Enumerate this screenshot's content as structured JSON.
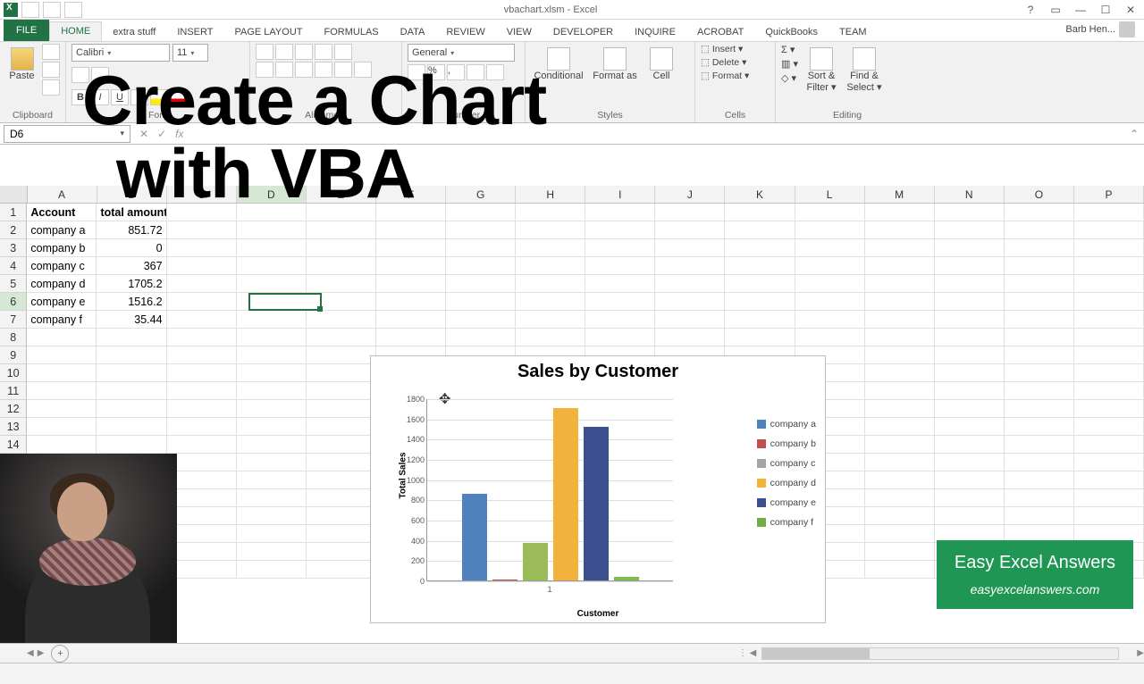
{
  "window": {
    "title": "vbachart.xlsm - Excel"
  },
  "qat": {
    "icons": [
      "xl",
      "save",
      "undo",
      "redo"
    ]
  },
  "tabs": [
    "FILE",
    "HOME",
    "extra stuff",
    "INSERT",
    "PAGE LAYOUT",
    "FORMULAS",
    "DATA",
    "REVIEW",
    "VIEW",
    "DEVELOPER",
    "INQUIRE",
    "ACROBAT",
    "QuickBooks",
    "TEAM"
  ],
  "active_tab": 1,
  "user": "Barb Hen...",
  "ribbon": {
    "clipboard": {
      "title": "Clipboard",
      "paste": "Paste"
    },
    "font": {
      "title": "Font",
      "family": "Calibri",
      "size": "11"
    },
    "number": {
      "title": "Number",
      "format": "General"
    },
    "styles": {
      "title": "Styles",
      "cond": "Conditional",
      "formatas": "Format as",
      "cell": "Cell"
    },
    "cells": {
      "title": "Cells",
      "insert": "Insert",
      "delete": "Delete",
      "format": "Format"
    },
    "editing": {
      "title": "Editing",
      "sort": "Sort &",
      "filter": "Filter ▾",
      "find": "Find &",
      "select": "Select ▾"
    }
  },
  "formula_bar": {
    "namebox": "D6",
    "fx_value": ""
  },
  "columns": [
    "A",
    "B",
    "C",
    "D",
    "E",
    "F",
    "G",
    "H",
    "I",
    "J",
    "K",
    "L",
    "M",
    "N",
    "O",
    "P"
  ],
  "header_row": {
    "col1": "Account",
    "col2": "total amount"
  },
  "rows": [
    {
      "acct": "company a",
      "val": "851.72"
    },
    {
      "acct": "company b",
      "val": "0"
    },
    {
      "acct": "company c",
      "val": "367"
    },
    {
      "acct": "company d",
      "val": "1705.2"
    },
    {
      "acct": "company e",
      "val": "1516.2"
    },
    {
      "acct": "company f",
      "val": "35.44"
    }
  ],
  "active_cell": "D6",
  "chart_data": {
    "type": "bar",
    "title": "Sales by Customer",
    "xlabel": "Customer",
    "ylabel": "Total Sales",
    "categories": [
      "1"
    ],
    "series": [
      {
        "name": "company a",
        "values": [
          851.72
        ],
        "color": "#4f81bd"
      },
      {
        "name": "company b",
        "values": [
          0
        ],
        "color": "#c0504d"
      },
      {
        "name": "company c",
        "values": [
          367
        ],
        "color": "#9bbb59"
      },
      {
        "name": "company d",
        "values": [
          1705.2
        ],
        "color": "#f2b33d"
      },
      {
        "name": "company e",
        "values": [
          1516.2
        ],
        "color": "#3b4f8f"
      },
      {
        "name": "company f",
        "values": [
          35.44
        ],
        "color": "#7fba52"
      }
    ],
    "ylim": [
      0,
      1800
    ],
    "yticks": [
      0,
      200,
      400,
      600,
      800,
      1000,
      1200,
      1400,
      1600,
      1800
    ]
  },
  "overlay": {
    "line1": "Create a Chart",
    "line2": "with VBA"
  },
  "watermark": {
    "l1": "Easy Excel Answers",
    "l2": "easyexcelanswers.com"
  },
  "sheettabs": {
    "add": "+"
  },
  "legend_colors": {
    "company a": "#4f81bd",
    "company b": "#c0504d",
    "company c": "#a5a5a5",
    "company d": "#f2b33d",
    "company e": "#3b4f8f",
    "company f": "#70ad47"
  }
}
